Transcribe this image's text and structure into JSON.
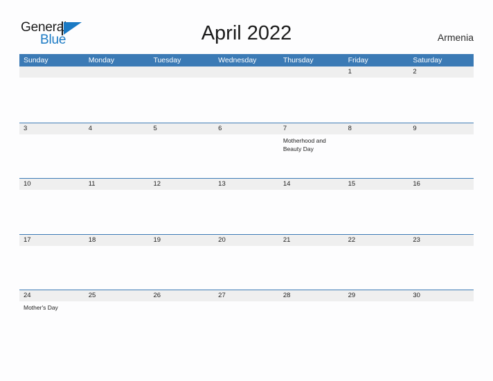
{
  "brand": {
    "name_part1": "General",
    "name_part2": "Blue",
    "mark_icon": "triangle-flag-icon",
    "accent_color": "#1b7ac4"
  },
  "header": {
    "title": "April 2022",
    "locale": "Armenia"
  },
  "colors": {
    "header_blue": "#3b7ab5",
    "band_gray": "#efefef",
    "page_background": "#fdfdfe",
    "text": "#1d1d1d"
  },
  "calendar": {
    "month": "April",
    "year": "2022",
    "weekday_headers": [
      "Sunday",
      "Monday",
      "Tuesday",
      "Wednesday",
      "Thursday",
      "Friday",
      "Saturday"
    ],
    "weeks": [
      {
        "days": [
          {
            "num": "",
            "events": []
          },
          {
            "num": "",
            "events": []
          },
          {
            "num": "",
            "events": []
          },
          {
            "num": "",
            "events": []
          },
          {
            "num": "",
            "events": []
          },
          {
            "num": "1",
            "events": []
          },
          {
            "num": "2",
            "events": []
          }
        ]
      },
      {
        "days": [
          {
            "num": "3",
            "events": []
          },
          {
            "num": "4",
            "events": []
          },
          {
            "num": "5",
            "events": []
          },
          {
            "num": "6",
            "events": []
          },
          {
            "num": "7",
            "events": [
              "Motherhood and Beauty Day"
            ]
          },
          {
            "num": "8",
            "events": []
          },
          {
            "num": "9",
            "events": []
          }
        ]
      },
      {
        "days": [
          {
            "num": "10",
            "events": []
          },
          {
            "num": "11",
            "events": []
          },
          {
            "num": "12",
            "events": []
          },
          {
            "num": "13",
            "events": []
          },
          {
            "num": "14",
            "events": []
          },
          {
            "num": "15",
            "events": []
          },
          {
            "num": "16",
            "events": []
          }
        ]
      },
      {
        "days": [
          {
            "num": "17",
            "events": []
          },
          {
            "num": "18",
            "events": []
          },
          {
            "num": "19",
            "events": []
          },
          {
            "num": "20",
            "events": []
          },
          {
            "num": "21",
            "events": []
          },
          {
            "num": "22",
            "events": []
          },
          {
            "num": "23",
            "events": []
          }
        ]
      },
      {
        "days": [
          {
            "num": "24",
            "events": [
              "Mother's Day"
            ]
          },
          {
            "num": "25",
            "events": []
          },
          {
            "num": "26",
            "events": []
          },
          {
            "num": "27",
            "events": []
          },
          {
            "num": "28",
            "events": []
          },
          {
            "num": "29",
            "events": []
          },
          {
            "num": "30",
            "events": []
          }
        ]
      }
    ]
  }
}
